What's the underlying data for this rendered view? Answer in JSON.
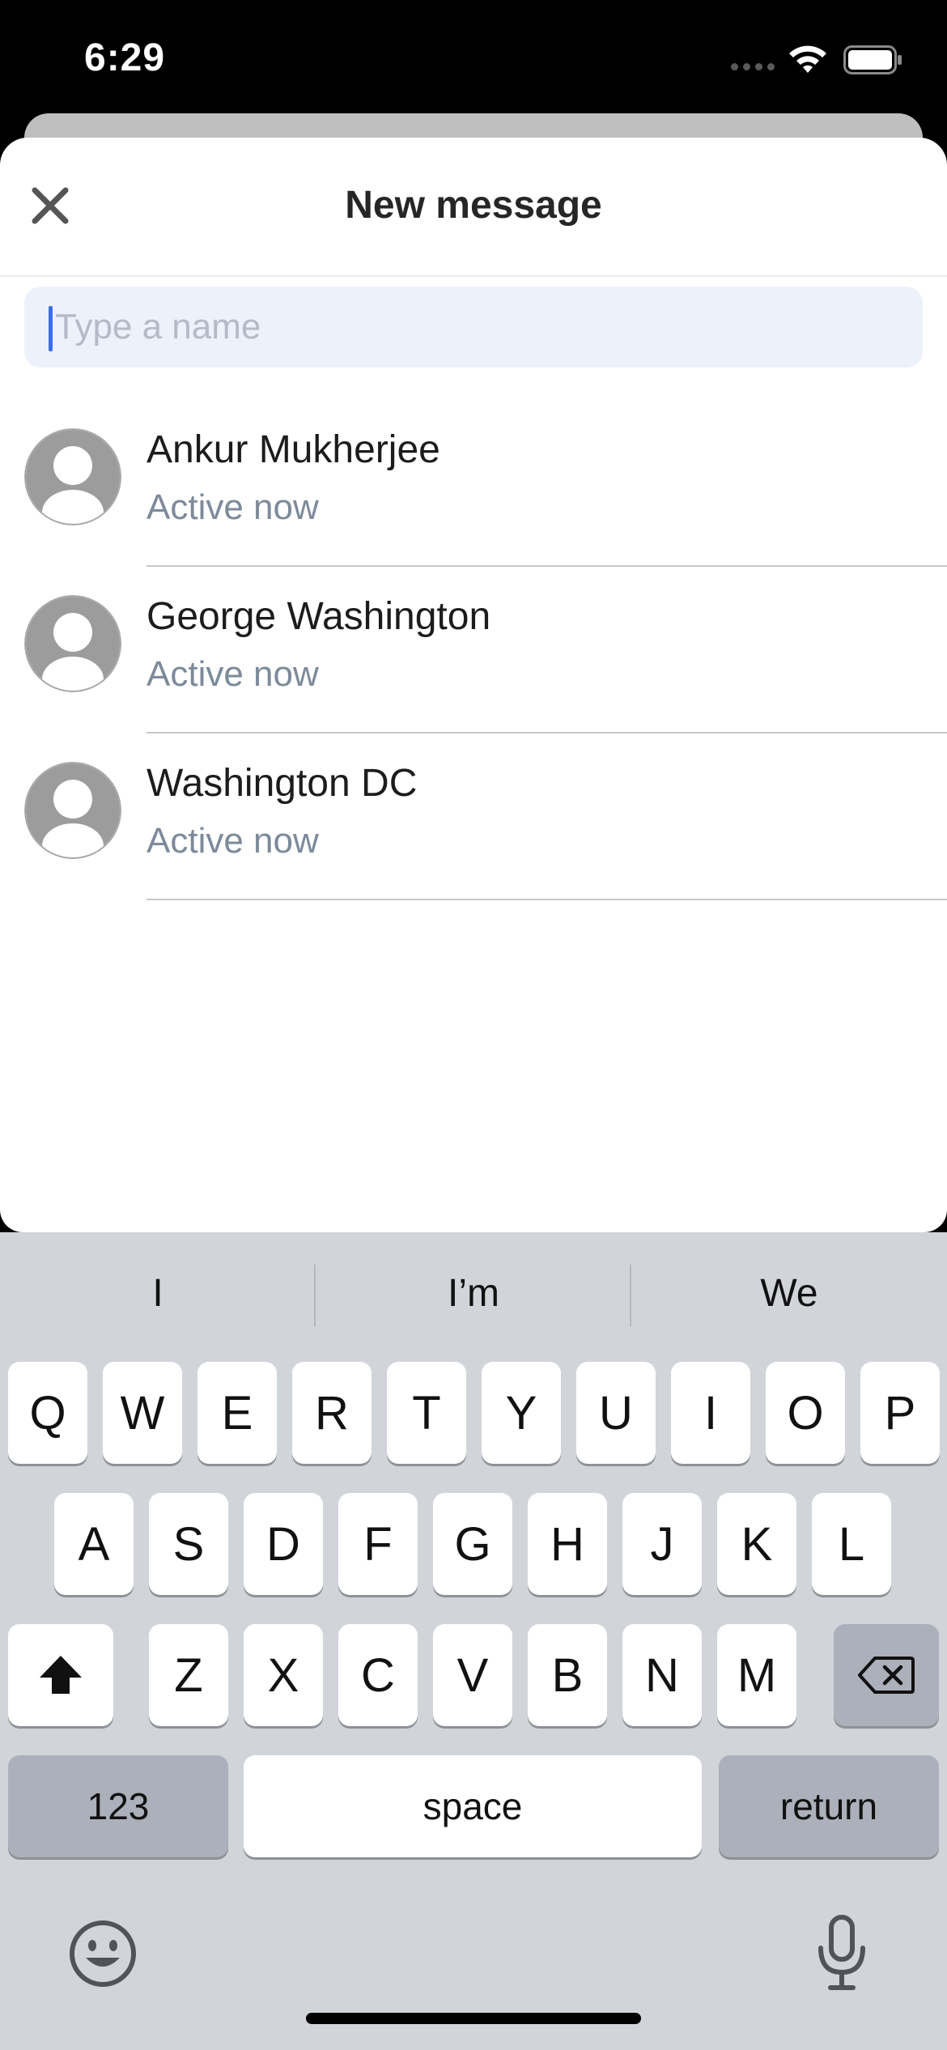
{
  "status_bar": {
    "time": "6:29"
  },
  "sheet": {
    "title": "New message",
    "search": {
      "placeholder": "Type a name",
      "value": ""
    }
  },
  "contacts": [
    {
      "name": "Ankur Mukherjee",
      "status": "Active now"
    },
    {
      "name": "George Washington",
      "status": "Active now"
    },
    {
      "name": "Washington DC",
      "status": "Active now"
    }
  ],
  "keyboard": {
    "suggestions": [
      "I",
      "I’m",
      "We"
    ],
    "row1": [
      "Q",
      "W",
      "E",
      "R",
      "T",
      "Y",
      "U",
      "I",
      "O",
      "P"
    ],
    "row2": [
      "A",
      "S",
      "D",
      "F",
      "G",
      "H",
      "J",
      "K",
      "L"
    ],
    "row3": [
      "Z",
      "X",
      "C",
      "V",
      "B",
      "N",
      "M"
    ],
    "numbers_label": "123",
    "space_label": "space",
    "return_label": "return"
  },
  "colors": {
    "accent": "#3b6cf4",
    "secondary_text": "#7d8a9a",
    "keyboard_bg": "#d1d4d9"
  }
}
